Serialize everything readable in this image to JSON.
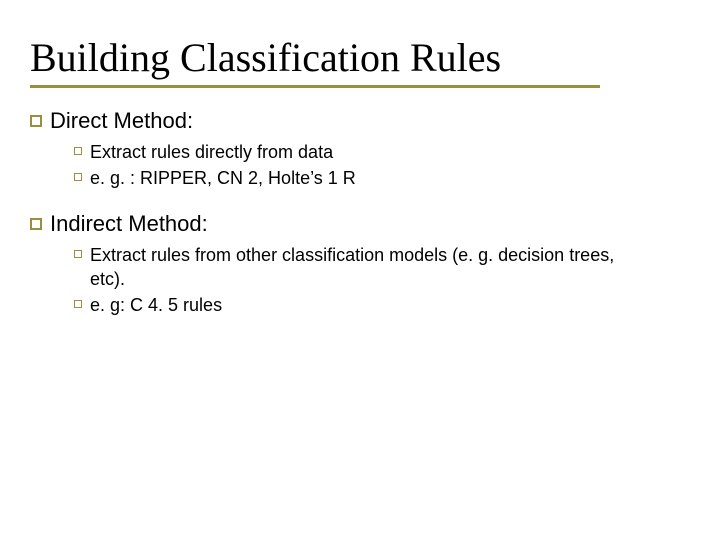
{
  "title": "Building Classification Rules",
  "sections": [
    {
      "heading": "Direct Method:",
      "items": [
        "Extract rules directly from data",
        "e. g. : RIPPER, CN 2, Holte’s 1 R"
      ]
    },
    {
      "heading": "Indirect Method:",
      "items": [
        "Extract rules from other classification models (e. g. decision trees, etc).",
        "e. g: C 4. 5 rules"
      ]
    }
  ]
}
